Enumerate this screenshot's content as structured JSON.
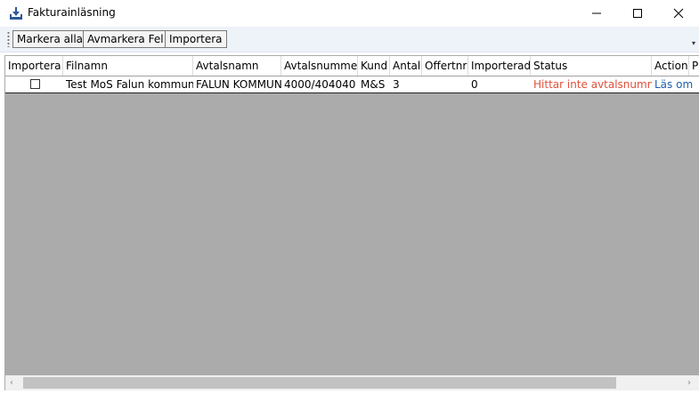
{
  "window": {
    "title": "Fakturainläsning"
  },
  "toolbar": {
    "select_all": "Markera alla",
    "deselect_errors": "Avmarkera Fel",
    "import": "Importera",
    "overflow_glyph": "▾"
  },
  "table": {
    "columns": [
      "Importera",
      "Filnamn",
      "Avtalsnamn",
      "Avtalsnummer",
      "Kund",
      "Antal",
      "Offertnr",
      "Importerad",
      "Status",
      "Action",
      "P"
    ],
    "rows": [
      {
        "importera": false,
        "filnamn": "Test MoS Falun kommun II",
        "avtalsnamn": "FALUN KOMMUN",
        "avtalsnummer": "4000/404040",
        "kund": "M&S",
        "antal": "3",
        "offertnr": "",
        "importerad": "0",
        "status": "Hittar inte avtalsnummer",
        "action": "Läs om"
      }
    ]
  },
  "colors": {
    "status_error": "#e0503c",
    "link": "#1f5fb0",
    "toolbar_bg": "#eef2f9",
    "grid_empty": "#ababab"
  }
}
